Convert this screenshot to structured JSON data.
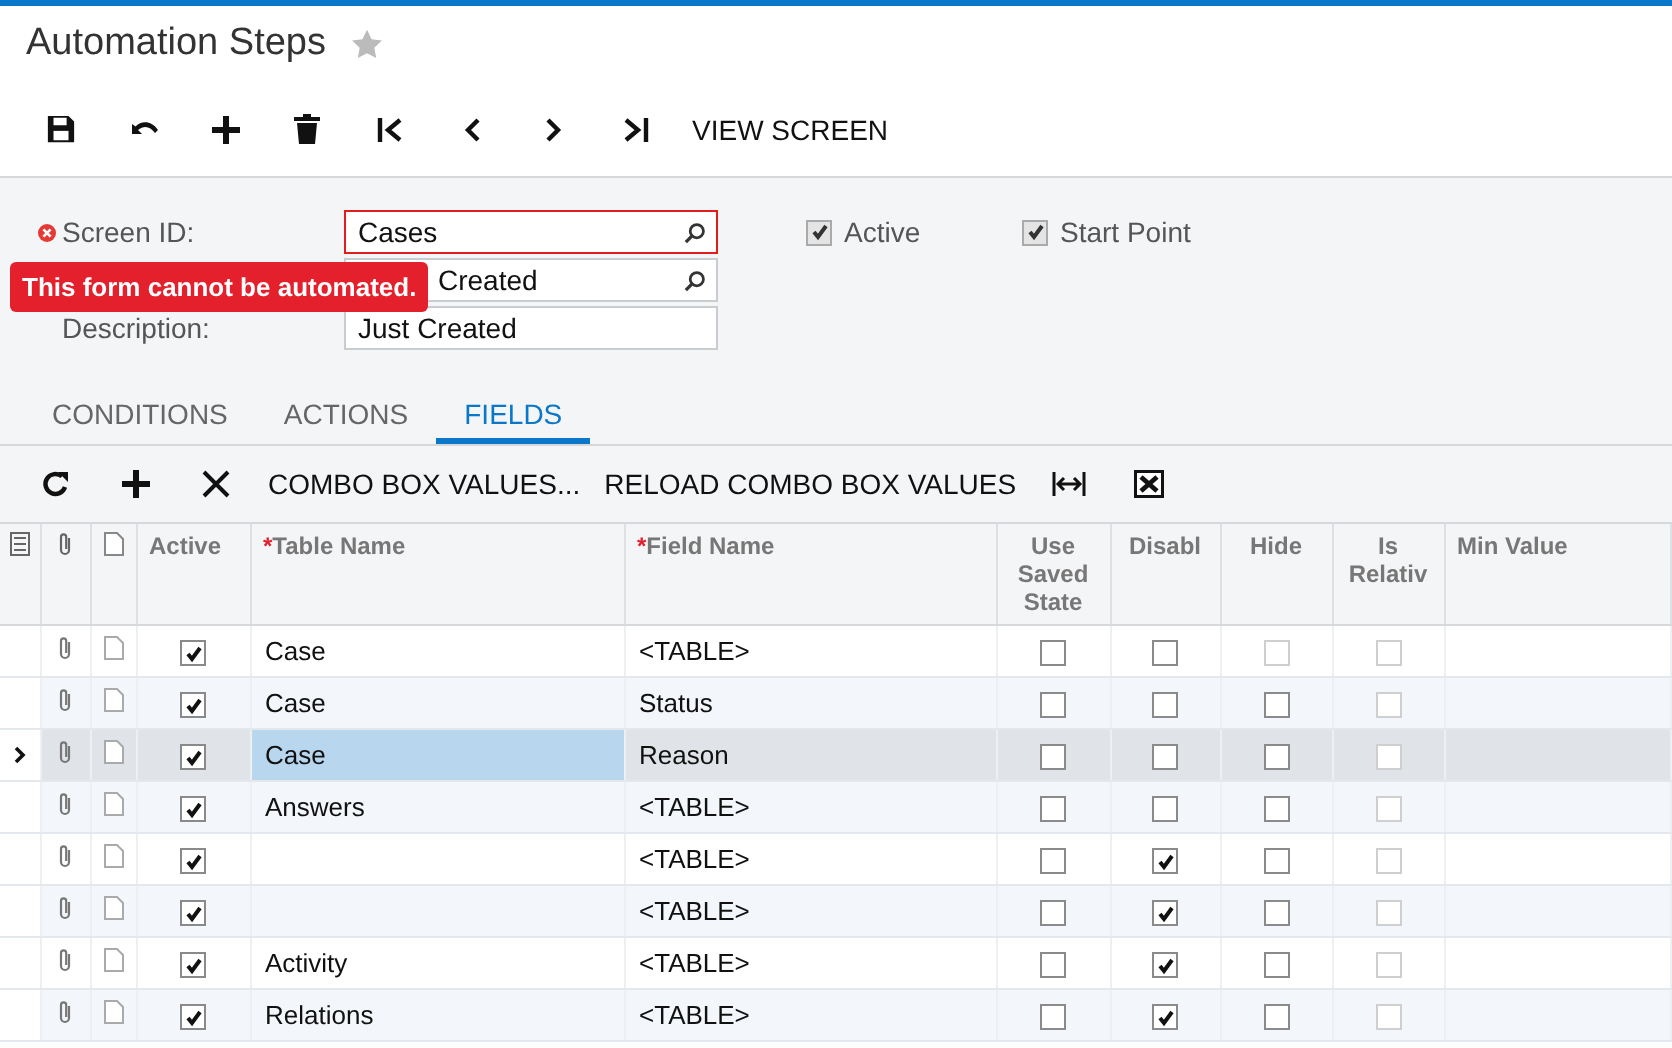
{
  "title": "Automation Steps",
  "toolbar": {
    "action": "VIEW SCREEN"
  },
  "form": {
    "screen_id": {
      "label": "Screen ID:",
      "value": "Cases",
      "error": true
    },
    "step_id": {
      "value": "Created"
    },
    "description": {
      "label": "Description:",
      "value": "Just Created"
    },
    "active": {
      "label": "Active",
      "checked": true
    },
    "start_point": {
      "label": "Start Point",
      "checked": true
    },
    "error_message": "This form cannot be automated."
  },
  "tabs": [
    {
      "label": "CONDITIONS",
      "selected": false
    },
    {
      "label": "ACTIONS",
      "selected": false
    },
    {
      "label": "FIELDS",
      "selected": true
    }
  ],
  "grid_toolbar": [
    "COMBO BOX VALUES...",
    "RELOAD COMBO BOX VALUES"
  ],
  "table": {
    "columns": [
      {
        "label": "Active"
      },
      {
        "label": "Table Name",
        "marker": "*"
      },
      {
        "label": "Field Name",
        "marker": "*"
      },
      {
        "label": "Use Saved State"
      },
      {
        "label": "Disabl"
      },
      {
        "label": "Hide"
      },
      {
        "label": "Is Relativ"
      },
      {
        "label": "Min Value"
      }
    ],
    "rows": [
      {
        "selected": false,
        "active": true,
        "table_name": "Case",
        "field_name": "<TABLE>",
        "checks": [
          {
            "checked": false,
            "disabled": false
          },
          {
            "checked": false,
            "disabled": false
          },
          {
            "checked": false,
            "disabled": true
          },
          {
            "checked": false,
            "disabled": true
          }
        ]
      },
      {
        "selected": false,
        "active": true,
        "table_name": "Case",
        "field_name": "Status",
        "checks": [
          {
            "checked": false,
            "disabled": false
          },
          {
            "checked": false,
            "disabled": false
          },
          {
            "checked": false,
            "disabled": false
          },
          {
            "checked": false,
            "disabled": true
          }
        ]
      },
      {
        "selected": true,
        "active": true,
        "table_name": "Case",
        "field_name": "Reason",
        "checks": [
          {
            "checked": false,
            "disabled": false
          },
          {
            "checked": false,
            "disabled": false
          },
          {
            "checked": false,
            "disabled": false
          },
          {
            "checked": false,
            "disabled": true
          }
        ]
      },
      {
        "selected": false,
        "active": true,
        "table_name": "Answers",
        "field_name": "<TABLE>",
        "checks": [
          {
            "checked": false,
            "disabled": false
          },
          {
            "checked": false,
            "disabled": false
          },
          {
            "checked": false,
            "disabled": false
          },
          {
            "checked": false,
            "disabled": true
          }
        ]
      },
      {
        "selected": false,
        "active": true,
        "table_name": "",
        "field_name": "<TABLE>",
        "checks": [
          {
            "checked": false,
            "disabled": false
          },
          {
            "checked": true,
            "disabled": false
          },
          {
            "checked": false,
            "disabled": false
          },
          {
            "checked": false,
            "disabled": true
          }
        ]
      },
      {
        "selected": false,
        "active": true,
        "table_name": "",
        "field_name": "<TABLE>",
        "checks": [
          {
            "checked": false,
            "disabled": false
          },
          {
            "checked": true,
            "disabled": false
          },
          {
            "checked": false,
            "disabled": false
          },
          {
            "checked": false,
            "disabled": true
          }
        ]
      },
      {
        "selected": false,
        "active": true,
        "table_name": "Activity",
        "field_name": "<TABLE>",
        "checks": [
          {
            "checked": false,
            "disabled": false
          },
          {
            "checked": true,
            "disabled": false
          },
          {
            "checked": false,
            "disabled": false
          },
          {
            "checked": false,
            "disabled": true
          }
        ]
      },
      {
        "selected": false,
        "active": true,
        "table_name": "Relations",
        "field_name": "<TABLE>",
        "checks": [
          {
            "checked": false,
            "disabled": false
          },
          {
            "checked": true,
            "disabled": false
          },
          {
            "checked": false,
            "disabled": false
          },
          {
            "checked": false,
            "disabled": true
          }
        ]
      }
    ]
  }
}
